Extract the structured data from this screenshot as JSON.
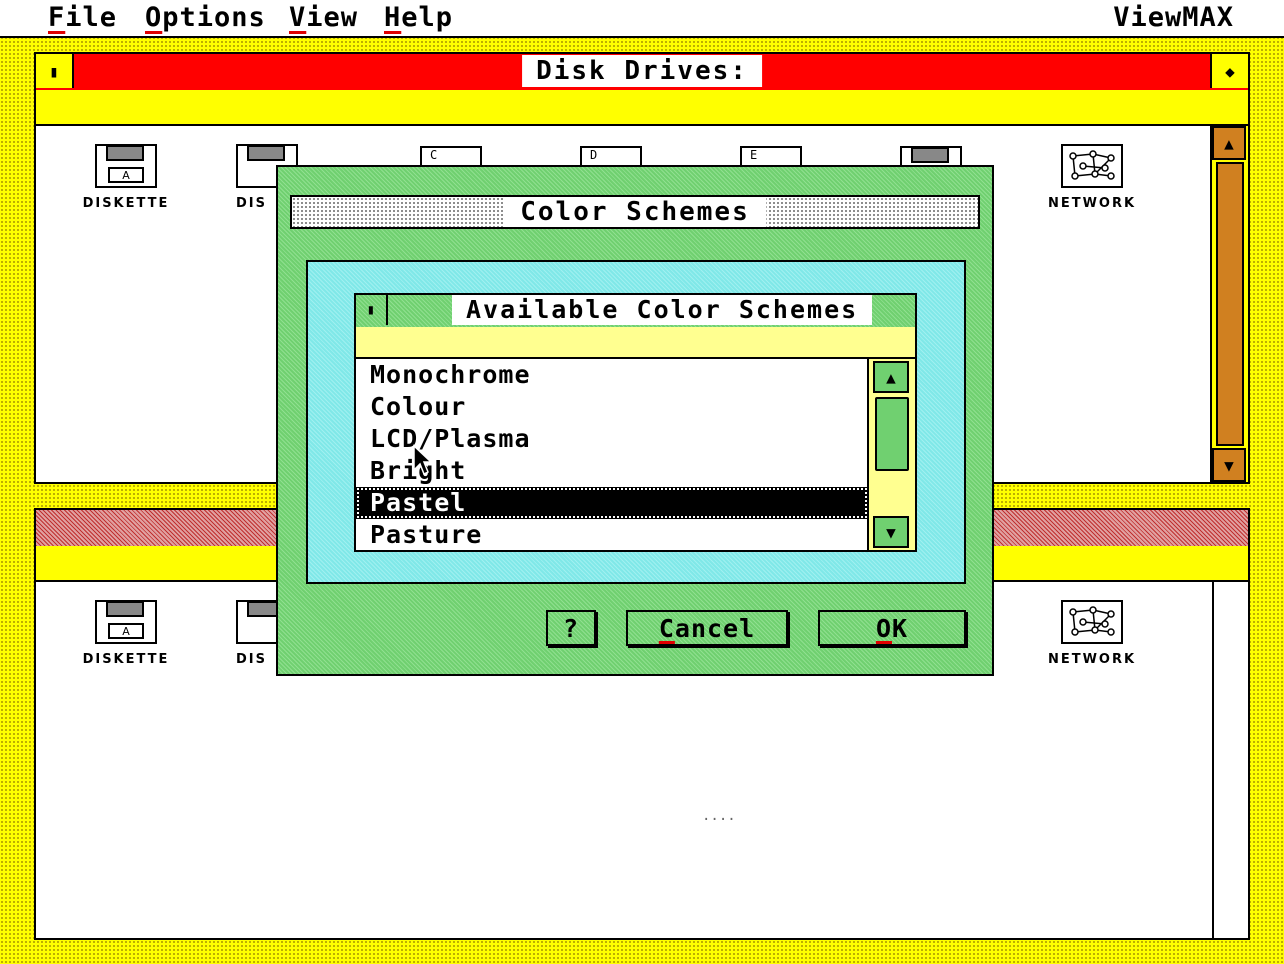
{
  "menubar": {
    "items": [
      {
        "label": "File",
        "hotkey": "F",
        "rest": "ile"
      },
      {
        "label": "Options",
        "hotkey": "O",
        "rest": "ptions"
      },
      {
        "label": "View",
        "hotkey": "V",
        "rest": "iew"
      },
      {
        "label": "Help",
        "hotkey": "H",
        "rest": "elp"
      }
    ],
    "brand": "ViewMAX",
    "brand_pre": "View",
    "brand_hot": "M",
    "brand_post": "AX"
  },
  "top_window": {
    "title": "Disk Drives:",
    "drives": [
      {
        "label": "DISKETTE",
        "letter": "A",
        "icon": "floppy-drive-icon"
      },
      {
        "label": "DIS",
        "letter": "",
        "icon": "floppy-drive-icon"
      },
      {
        "label": "",
        "letter": "C",
        "icon": "hard-drive-icon"
      },
      {
        "label": "",
        "letter": "D",
        "icon": "hard-drive-icon"
      },
      {
        "label": "",
        "letter": "E",
        "icon": "hard-drive-icon"
      },
      {
        "label": "",
        "letter": "",
        "icon": "floppy-drive-icon"
      },
      {
        "label": "NETWORK",
        "letter": "",
        "icon": "network-icon"
      }
    ]
  },
  "bottom_window": {
    "drives": [
      {
        "label": "DISKETTE",
        "letter": "A",
        "icon": "floppy-drive-icon"
      },
      {
        "label": "DIS",
        "letter": "",
        "icon": "floppy-drive-icon"
      },
      {
        "label": "NETWORK",
        "letter": "",
        "icon": "network-icon"
      }
    ],
    "status_dots": "...."
  },
  "dialog": {
    "title": "Color Schemes",
    "list_title": "Available Color Schemes",
    "items": [
      "Monochrome",
      "Colour",
      "LCD/Plasma",
      "Bright",
      "Pastel",
      "Pasture"
    ],
    "selected": "Pastel",
    "buttons": {
      "help": "?",
      "cancel": "Cancel",
      "cancel_hot": "C",
      "cancel_rest": "ancel",
      "ok": "OK",
      "ok_hot": "O",
      "ok_rest": "K"
    }
  },
  "colors": {
    "desktop": "#ffff00",
    "title_active": "#ff0000",
    "dialog_bg": "#70d070",
    "list_frame": "#80e8e8",
    "hotkey_underline": "#e00000"
  }
}
